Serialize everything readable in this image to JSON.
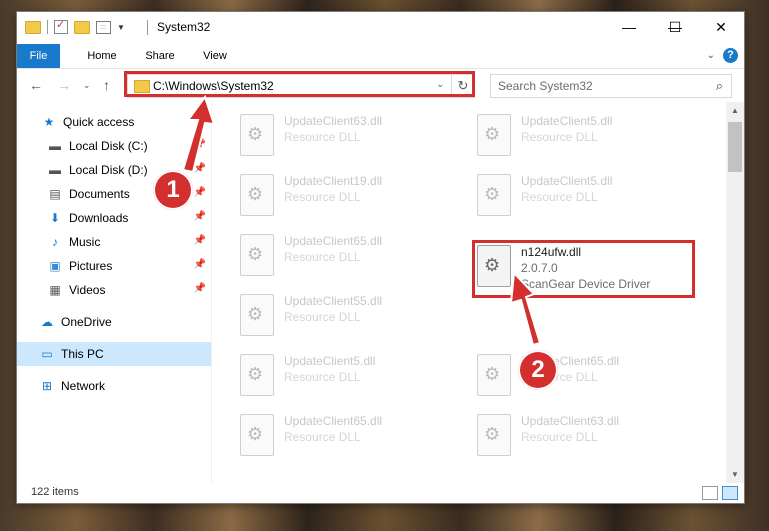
{
  "window": {
    "title": "System32",
    "controls": {
      "minimize": "—",
      "maximize": "☐",
      "close": "✕"
    }
  },
  "ribbon": {
    "tabs": [
      "File",
      "Home",
      "Share",
      "View"
    ]
  },
  "navbar": {
    "address": "C:\\Windows\\System32",
    "search_placeholder": "Search System32"
  },
  "sidebar": {
    "quick_access": "Quick access",
    "items": [
      {
        "label": "Local Disk (C:)",
        "icon": "drive-icon",
        "pinned": true
      },
      {
        "label": "Local Disk (D:)",
        "icon": "drive-icon",
        "pinned": true
      },
      {
        "label": "Documents",
        "icon": "documents-icon",
        "pinned": true
      },
      {
        "label": "Downloads",
        "icon": "downloads-icon",
        "pinned": true
      },
      {
        "label": "Music",
        "icon": "music-icon",
        "pinned": true
      },
      {
        "label": "Pictures",
        "icon": "pictures-icon",
        "pinned": true
      },
      {
        "label": "Videos",
        "icon": "videos-icon",
        "pinned": true
      }
    ],
    "onedrive": "OneDrive",
    "this_pc": "This PC",
    "network": "Network"
  },
  "files": {
    "left": [
      {
        "name": "UpdateClient63.dll",
        "desc": "Resource DLL"
      },
      {
        "name": "UpdateClient19.dll",
        "desc": "Resource DLL"
      },
      {
        "name": "UpdateClient65.dll",
        "desc": "Resource DLL"
      },
      {
        "name": "UpdateClient55.dll",
        "desc": "Resource DLL"
      },
      {
        "name": "UpdateClient5.dll",
        "desc": "Resource DLL"
      },
      {
        "name": "UpdateClient65.dll",
        "desc": "Resource DLL"
      }
    ],
    "right": [
      {
        "name": "UpdateClient5.dll",
        "desc": "Resource DLL"
      },
      {
        "name": "UpdateClient5.dll",
        "desc": "Resource DLL"
      },
      {
        "name": "UpdateClient65.dll",
        "desc": "Resource DLL"
      },
      {
        "name": "UpdateClient63.dll",
        "desc": "Resource DLL"
      }
    ],
    "highlighted": {
      "name": "n124ufw.dll",
      "version": "2.0.7.0",
      "desc": "ScanGear Device Driver"
    }
  },
  "status": {
    "items": "122 items"
  },
  "annotations": {
    "step1": "1",
    "step2": "2",
    "color": "#d32f2f"
  }
}
